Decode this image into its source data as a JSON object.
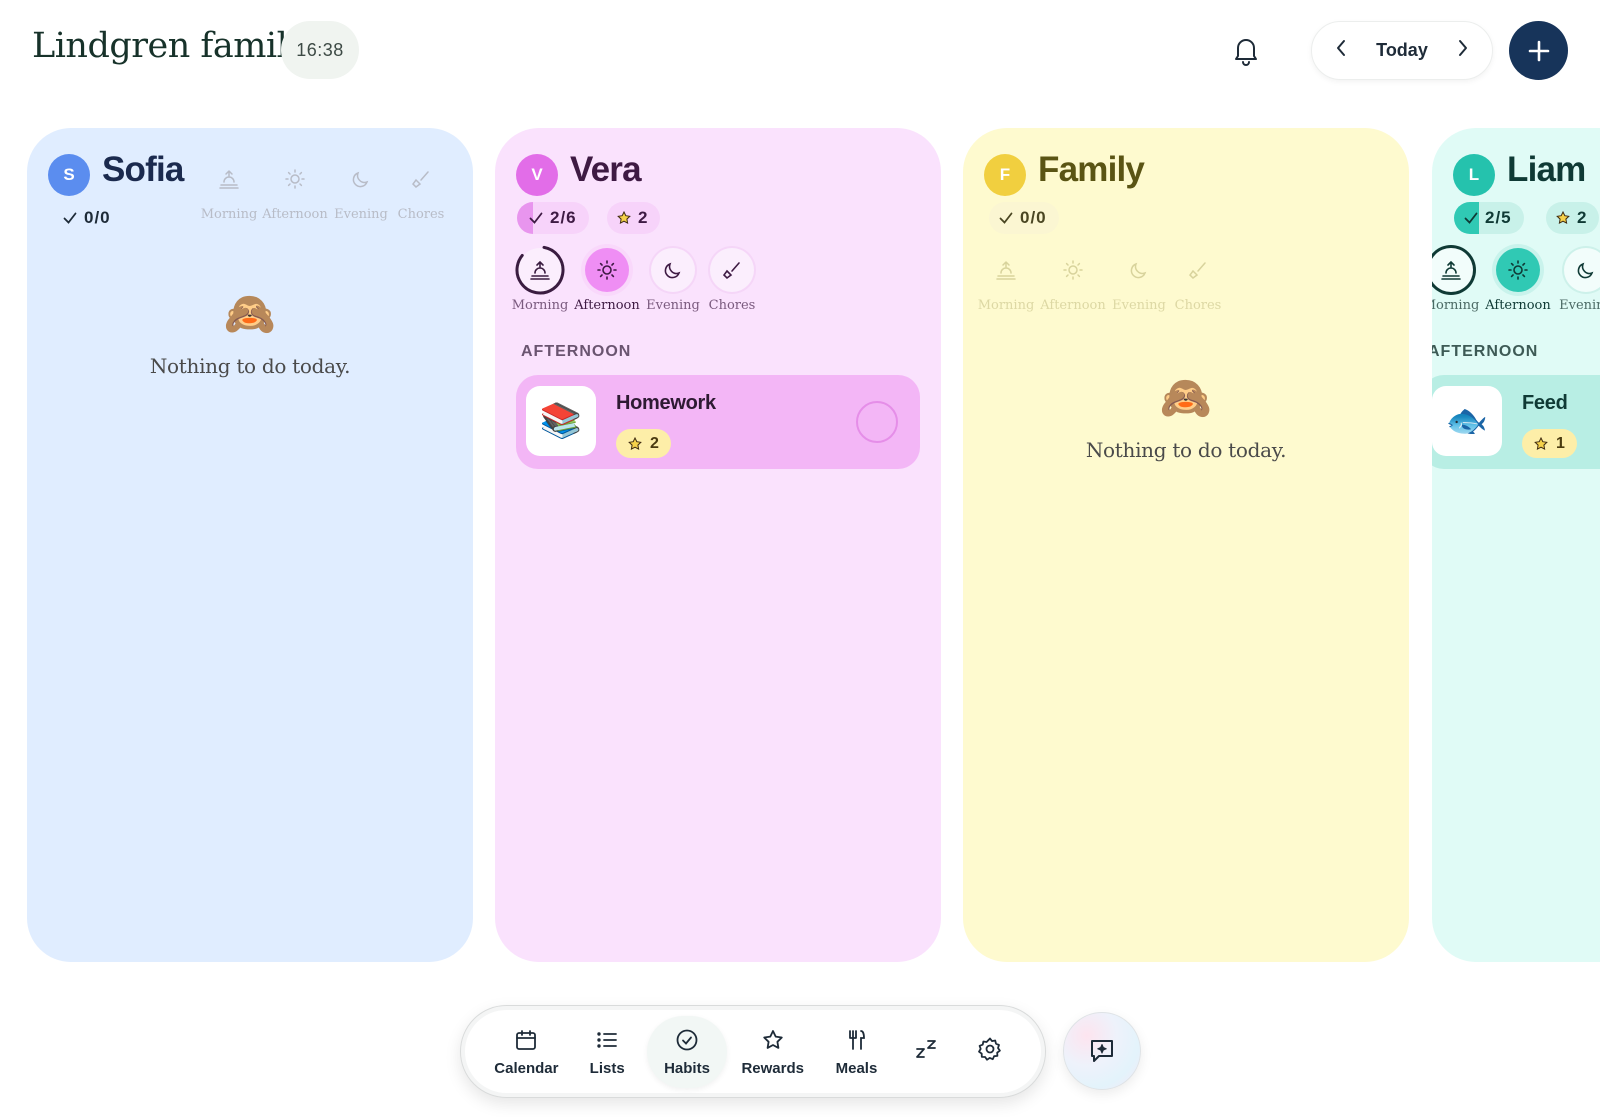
{
  "header": {
    "title": "Lindgren family",
    "time": "16:38",
    "date_label": "Today"
  },
  "periods": [
    "Morning",
    "Afternoon",
    "Evening",
    "Chores"
  ],
  "columns": {
    "sofia": {
      "initial": "S",
      "name": "Sofia",
      "progress": "0/0",
      "empty_text": "Nothing to do today.",
      "empty_emoji": "🙈",
      "colors": {
        "bg": "#e0edff",
        "avatar": "#5b8def",
        "name": "#1b2a4e"
      }
    },
    "vera": {
      "initial": "V",
      "name": "Vera",
      "progress": "2/6",
      "stars": "2",
      "active_period": "Afternoon",
      "section_label": "AFTERNOON",
      "task": {
        "name": "Homework",
        "emoji": "📚",
        "stars": "2"
      },
      "colors": {
        "bg": "#fae2fd",
        "avatar": "#e26de8",
        "name": "#3e1a43"
      }
    },
    "family": {
      "initial": "F",
      "name": "Family",
      "progress": "0/0",
      "empty_text": "Nothing to do today.",
      "empty_emoji": "🙈",
      "colors": {
        "bg": "#fefacf",
        "avatar": "#f1cf3f",
        "name": "#5a5414"
      }
    },
    "liam": {
      "initial": "L",
      "name": "Liam",
      "progress": "2/5",
      "stars": "2",
      "active_period": "Afternoon",
      "section_label": "AFTERNOON",
      "task": {
        "name": "Feed",
        "emoji": "🐟",
        "stars": "1"
      },
      "colors": {
        "bg": "#e0fbf6",
        "avatar": "#25c2ad",
        "name": "#0f3a35"
      }
    }
  },
  "nav": {
    "calendar": "Calendar",
    "lists": "Lists",
    "habits": "Habits",
    "rewards": "Rewards",
    "meals": "Meals",
    "active": "Habits"
  }
}
